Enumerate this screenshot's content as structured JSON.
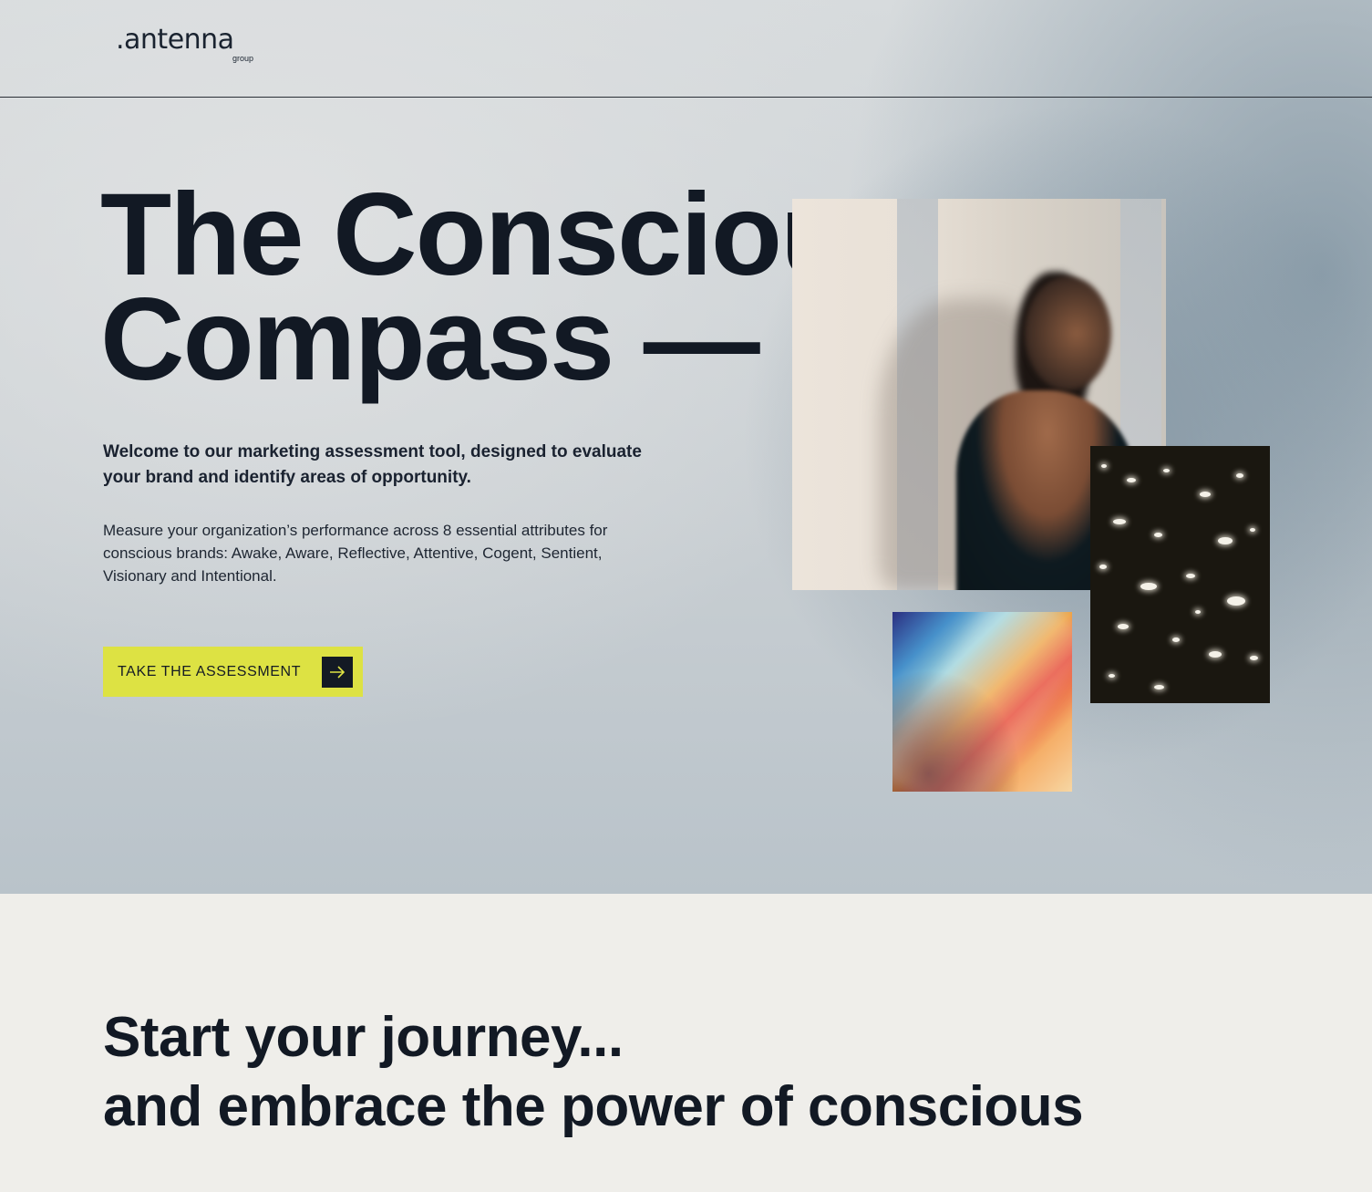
{
  "brand": {
    "logo_text": ".antenna",
    "logo_sub": "group"
  },
  "hero": {
    "title_line1": "The Conscious",
    "title_line2": "Compass —",
    "intro": "Welcome to our marketing assessment tool, designed to evaluate your brand and identify areas of opportunity.",
    "description": "Measure your organization’s performance across 8 essential attributes for conscious brands: Awake, Aware, Reflective, Attentive, Cogent, Sentient, Visionary and Intentional.",
    "cta_label": "TAKE THE ASSESSMENT",
    "cta_icon": "arrow-right-icon"
  },
  "journey": {
    "line1": "Start your journey...",
    "line2": "and embrace the power of conscious"
  },
  "colors": {
    "accent": "#dde243",
    "ink": "#131a24",
    "section_bg": "#efeeea"
  }
}
